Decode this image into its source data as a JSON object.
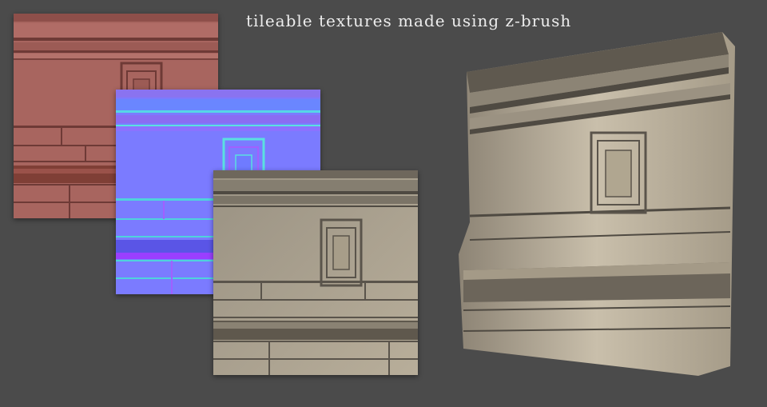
{
  "header": {
    "title": "tileable textures made using z-brush"
  },
  "panels": {
    "clay": {
      "kind": "zbrush-clay-render",
      "color": "#a8655f"
    },
    "normal": {
      "kind": "normal-map",
      "color": "#7b7bff"
    },
    "diffuse": {
      "kind": "diffuse-texture",
      "color": "#b8ab95"
    },
    "wall": {
      "kind": "3d-wall-preview",
      "color": "#c7bca8"
    }
  },
  "colors": {
    "background": "#4b4b4b",
    "title": "#ececec"
  }
}
